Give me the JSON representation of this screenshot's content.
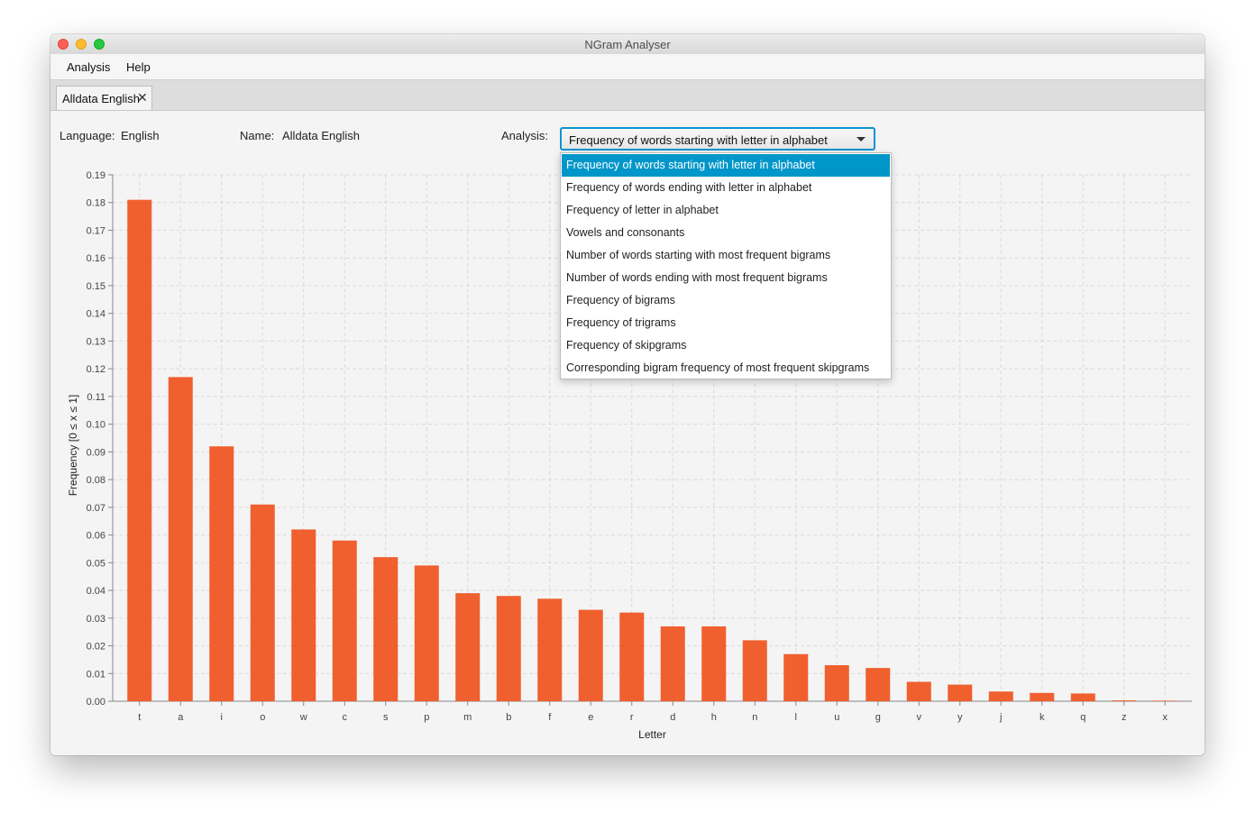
{
  "window": {
    "title": "NGram Analyser"
  },
  "menu": {
    "items": [
      "Analysis",
      "Help"
    ]
  },
  "tab": {
    "label": "Alldata English",
    "close_glyph": "✕"
  },
  "info": {
    "language_label": "Language:",
    "language_value": "English",
    "name_label": "Name:",
    "name_value": "Alldata English",
    "analysis_label": "Analysis:"
  },
  "analysis_select": {
    "selected": "Frequency of words starting with letter in alphabet",
    "options": [
      "Frequency of words starting with letter in alphabet",
      "Frequency of words ending with letter in alphabet",
      "Frequency of letter in alphabet",
      "Vowels and consonants",
      "Number of words starting with most frequent bigrams",
      "Number of words ending with most frequent bigrams",
      "Frequency of bigrams",
      "Frequency of trigrams",
      "Frequency of skipgrams",
      "Corresponding bigram frequency of most frequent skipgrams"
    ],
    "highlighted_index": 0
  },
  "colors": {
    "bar": "#f05f2e",
    "accent": "#0096c9"
  },
  "chart_data": {
    "type": "bar",
    "categories": [
      "t",
      "a",
      "i",
      "o",
      "w",
      "c",
      "s",
      "p",
      "m",
      "b",
      "f",
      "e",
      "r",
      "d",
      "h",
      "n",
      "l",
      "u",
      "g",
      "v",
      "y",
      "j",
      "k",
      "q",
      "z",
      "x"
    ],
    "values": [
      0.181,
      0.117,
      0.092,
      0.071,
      0.062,
      0.058,
      0.052,
      0.049,
      0.039,
      0.038,
      0.037,
      0.033,
      0.032,
      0.027,
      0.027,
      0.022,
      0.017,
      0.013,
      0.012,
      0.007,
      0.006,
      0.0035,
      0.003,
      0.0028,
      0.0003,
      0.0002
    ],
    "xlabel": "Letter",
    "ylabel": "Frequency [0 ≤ x ≤ 1]",
    "ylim": [
      0,
      0.19
    ],
    "yticks": [
      "0.00",
      "0.01",
      "0.02",
      "0.03",
      "0.04",
      "0.05",
      "0.06",
      "0.07",
      "0.08",
      "0.09",
      "0.10",
      "0.11",
      "0.12",
      "0.13",
      "0.14",
      "0.15",
      "0.16",
      "0.17",
      "0.18",
      "0.19"
    ],
    "grid": true,
    "legend": "none"
  }
}
